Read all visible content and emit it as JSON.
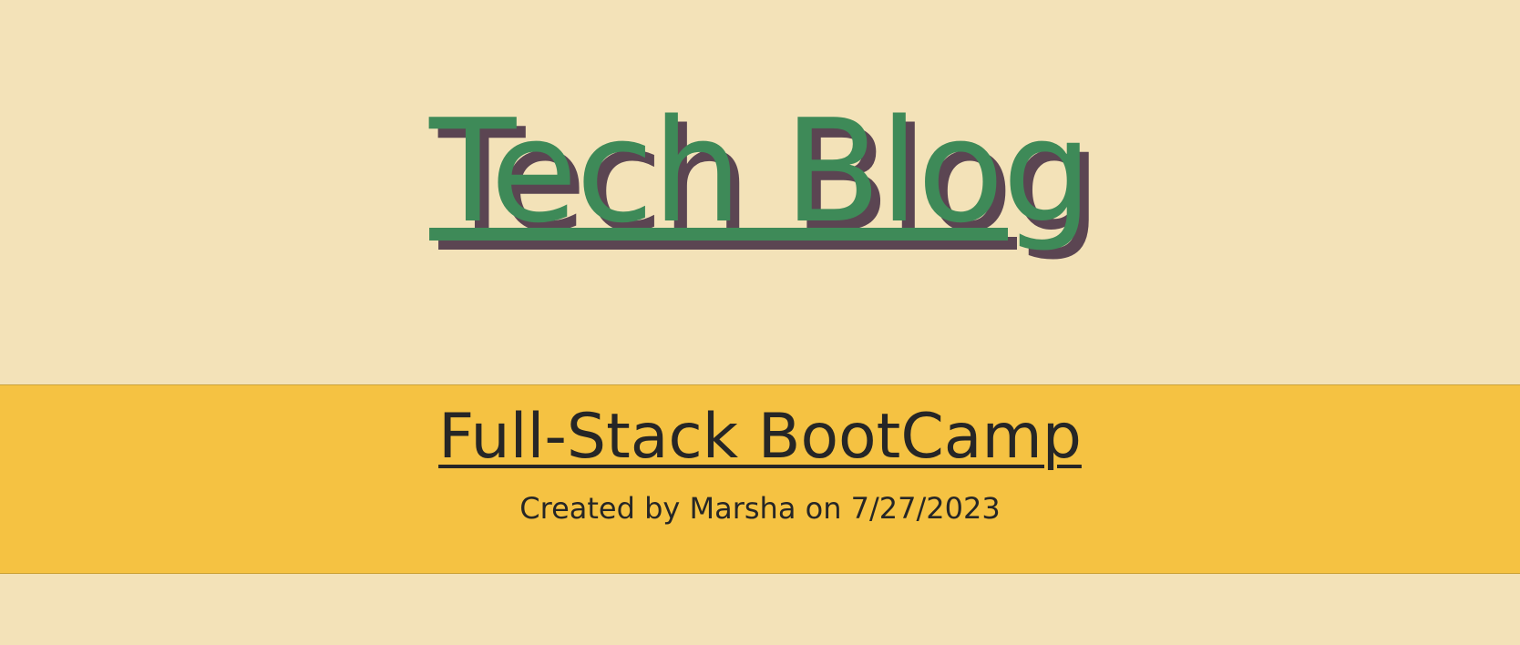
{
  "header": {
    "title": "Tech Blog"
  },
  "posts": [
    {
      "title": "Full-Stack BootCamp",
      "meta": "Created by Marsha on 7/27/2023"
    }
  ],
  "colors": {
    "page_background": "#f3e2b8",
    "title_green": "#3e8a58",
    "title_shadow": "#5b4552",
    "post_card": "#f5c242",
    "text_dark": "#262626"
  }
}
